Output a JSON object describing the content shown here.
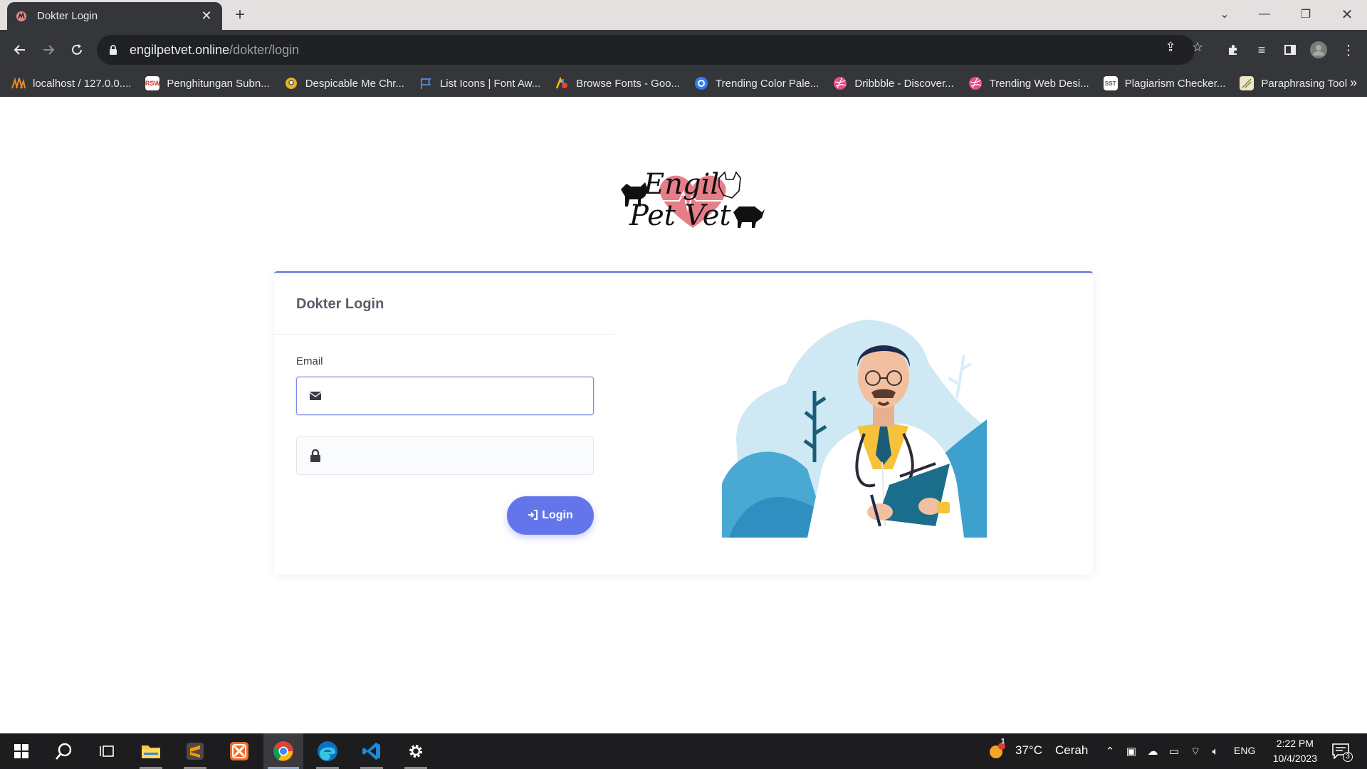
{
  "browser": {
    "tab_title": "Dokter Login",
    "url_host": "engilpetvet.online",
    "url_path": "/dokter/login",
    "bookmarks": [
      {
        "label": "localhost / 127.0.0....",
        "icon": "phpmyadmin-icon",
        "color": "#f28b1b"
      },
      {
        "label": "Penghitungan Subn...",
        "icon": "rsw-icon",
        "color": "#c0392b"
      },
      {
        "label": "Despicable Me Chr...",
        "icon": "minion-icon",
        "color": "#e6b52e"
      },
      {
        "label": "List Icons | Font Aw...",
        "icon": "flag-icon",
        "color": "#5a8ad6"
      },
      {
        "label": "Browse Fonts - Goo...",
        "icon": "google-fonts-icon",
        "color": "#4285f4"
      },
      {
        "label": "Trending Color Pale...",
        "icon": "coolors-icon",
        "color": "#2f7df5"
      },
      {
        "label": "Dribbble - Discover...",
        "icon": "dribbble-icon",
        "color": "#ea4c89"
      },
      {
        "label": "Trending Web Desi...",
        "icon": "dribbble-icon",
        "color": "#ea4c89"
      },
      {
        "label": "Plagiarism Checker...",
        "icon": "sst-icon",
        "color": "#ffffff"
      },
      {
        "label": "Paraphrasing Tool",
        "icon": "quillbot-icon",
        "color": "#d8c79a"
      }
    ]
  },
  "page": {
    "logo_line1": "Engil",
    "logo_line2": "Pet Vet",
    "card_title": "Dokter Login",
    "email_label": "Email",
    "email_value": "",
    "password_value": "",
    "login_label": "Login",
    "accent_color": "#6475ec"
  },
  "taskbar": {
    "weather_temp": "37°C",
    "weather_text": "Cerah",
    "language": "ENG",
    "time": "2:22 PM",
    "date": "10/4/2023",
    "notification_count": "3",
    "weather_badge": "1"
  }
}
